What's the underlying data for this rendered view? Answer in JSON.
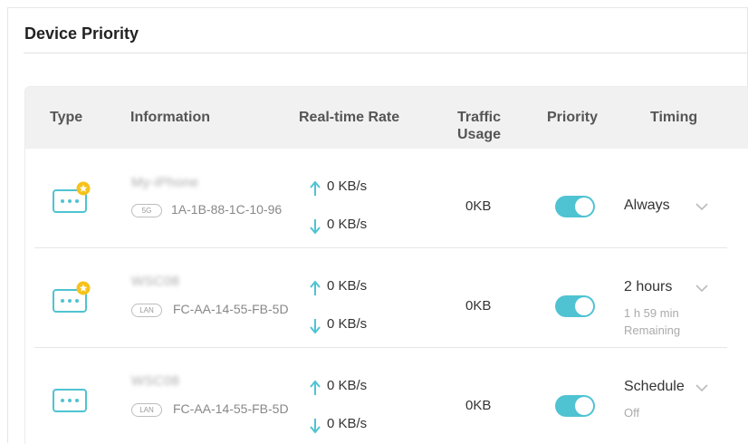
{
  "panel": {
    "title": "Device Priority"
  },
  "table": {
    "headers": {
      "type": "Type",
      "information": "Information",
      "rate": "Real-time Rate",
      "traffic_line1": "Traffic",
      "traffic_line2": "Usage",
      "priority": "Priority",
      "timing": "Timing"
    },
    "rows": [
      {
        "name": "My-iPhone",
        "connection": "5G",
        "mac": "1A-1B-88-1C-10-96",
        "upload": "0 KB/s",
        "download": "0 KB/s",
        "usage": "0KB",
        "priority_on": true,
        "timing": "Always",
        "timing_note1": "",
        "timing_note2": "",
        "starred": true
      },
      {
        "name": "WSC08",
        "connection": "LAN",
        "mac": "FC-AA-14-55-FB-5D",
        "upload": "0 KB/s",
        "download": "0 KB/s",
        "usage": "0KB",
        "priority_on": true,
        "timing": "2 hours",
        "timing_note1": "1 h 59 min",
        "timing_note2": "Remaining",
        "starred": true
      },
      {
        "name": "WSC08",
        "connection": "LAN",
        "mac": "FC-AA-14-55-FB-5D",
        "upload": "0 KB/s",
        "download": "0 KB/s",
        "usage": "0KB",
        "priority_on": true,
        "timing": "Schedule",
        "timing_note1": "Off",
        "timing_note2": "",
        "starred": false
      }
    ]
  },
  "colors": {
    "accent": "#4fc3d2",
    "star": "#f7c21a",
    "header_bg": "#f1f1f1"
  },
  "icons": {
    "device": "device-dots-icon",
    "star": "star-badge-icon",
    "up": "arrow-up-icon",
    "down": "arrow-down-icon",
    "dropdown": "chevron-down-icon"
  }
}
